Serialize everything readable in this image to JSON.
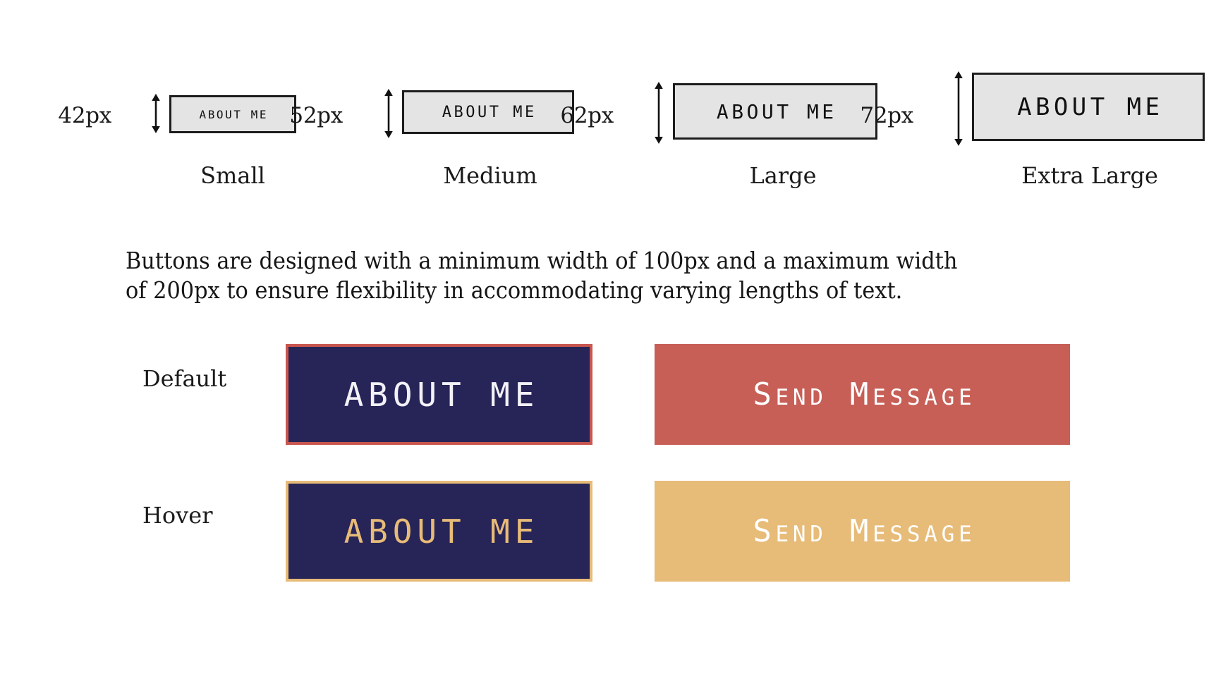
{
  "sizes": {
    "items": [
      {
        "dimension": "42px",
        "caption": "Small",
        "button_label": "ABOUT ME",
        "button_width": 180,
        "button_height": 54,
        "font_size": 16
      },
      {
        "dimension": "52px",
        "caption": "Medium",
        "button_label": "ABOUT ME",
        "button_width": 244,
        "button_height": 62,
        "font_size": 22
      },
      {
        "dimension": "62px",
        "caption": "Large",
        "button_label": "ABOUT ME",
        "button_width": 290,
        "button_height": 80,
        "font_size": 28
      },
      {
        "dimension": "72px",
        "caption": "Extra Large",
        "button_label": "ABOUT ME",
        "button_width": 330,
        "button_height": 97,
        "font_size": 34
      }
    ],
    "button_fill": "#e4e4e4",
    "button_border": "#1d1d1d",
    "button_text_color": "#111111"
  },
  "spec": {
    "line1": "Buttons are designed with a minimum width of 100px and a maximum width",
    "line2": "of 200px to ensure flexibility in accommodating varying lengths of text."
  },
  "states": {
    "rows": [
      {
        "label": "Default",
        "primary": {
          "text": "ABOUT ME",
          "background": "#272458",
          "text_color": "#f2f2f7",
          "border_color": "#c8564f"
        },
        "secondary": {
          "text": "Send Message",
          "background": "#c75f57",
          "text_color": "#ffffff",
          "border_color": "#c75f57"
        }
      },
      {
        "label": "Hover",
        "primary": {
          "text": "ABOUT ME",
          "background": "#272458",
          "text_color": "#e7bb78",
          "border_color": "#e7bb78"
        },
        "secondary": {
          "text": "Send Message",
          "background": "#e7bb78",
          "text_color": "#ffffff",
          "border_color": "#e7bb78"
        }
      }
    ]
  },
  "palette": {
    "navy": "#272458",
    "red": "#c75f57",
    "gold": "#e7bb78",
    "white": "#ffffff",
    "gray_fill": "#e4e4e4",
    "ink": "#1d1d1d"
  }
}
